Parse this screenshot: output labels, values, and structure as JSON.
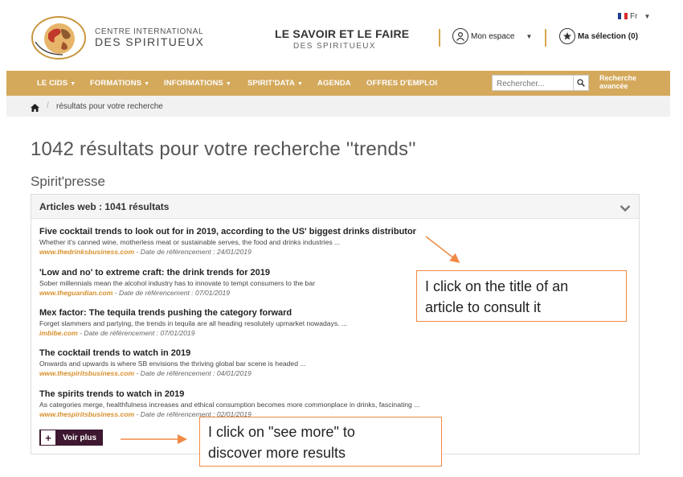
{
  "header": {
    "logo_line1": "CENTRE INTERNATIONAL",
    "logo_line2": "DES SPIRITUEUX",
    "tagline_line1": "LE SAVOIR ET LE FAIRE",
    "tagline_line2": "DES SPIRITUEUX",
    "language": "Fr",
    "account_label": "Mon espace",
    "selection_label": "Ma sélection (0)"
  },
  "nav": {
    "items": [
      "LE CIDS",
      "FORMATIONS",
      "INFORMATIONS",
      "SPIRIT'DATA",
      "AGENDA",
      "OFFRES D'EMPLOI"
    ],
    "search_placeholder": "Rechercher...",
    "advanced_line1": "Recherche",
    "advanced_line2": "avancée"
  },
  "breadcrumb": {
    "current": "résultats pour votre recherche"
  },
  "main": {
    "results_title": "1042 résultats pour votre recherche ''trends''",
    "section_title": "Spirit'presse",
    "panel_title": "Articles web : 1041 résultats",
    "articles": [
      {
        "title": "Five cocktail trends to look out for in 2019, according to the US' biggest drinks distributor",
        "desc": "Whether it's canned wine, motherless meat or sustainable serves, the food and drinks industries ...",
        "source": "www.thedrinksbusiness.com",
        "date": " - Date de référencement : 24/01/2019"
      },
      {
        "title": "'Low and no' to extreme craft: the drink trends for 2019",
        "desc": "Sober millennials mean the alcohol industry has to innovate to tempt consumers to the bar",
        "source": "www.theguardian.com",
        "date": " - Date de référencement : 07/01/2019"
      },
      {
        "title": "Mex factor: The tequila trends pushing the category forward",
        "desc": "Forget slammers and partying, the trends in tequila are all heading resolutely upmarket nowadays. ...",
        "source": "imbibe.com",
        "date": " - Date de référencement : 07/01/2019"
      },
      {
        "title": "The cocktail trends to watch in 2019",
        "desc": "Onwards and upwards is where SB envisions the thriving global bar scene is headed ...",
        "source": "www.thespiritsbusiness.com",
        "date": " - Date de référencement : 04/01/2019"
      },
      {
        "title": "The spirits trends to watch in 2019",
        "desc": "As categories merge, healthfulness increases and ethical consumption becomes more commonplace in drinks, fascinating ...",
        "source": "www.thespiritsbusiness.com",
        "date": " - Date de référencement : 02/01/2019"
      }
    ],
    "see_more_label": "Voir plus"
  },
  "annotations": {
    "callout1_line1": "I click on the title of an",
    "callout1_line2": "article to consult it",
    "callout2_line1": "I click on \"see more\" to",
    "callout2_line2": "discover more results"
  },
  "colors": {
    "nav_bg": "#d4a95c",
    "source_link": "#d8902c",
    "button_bg": "#3d1830",
    "callout_border": "#f08a45"
  }
}
